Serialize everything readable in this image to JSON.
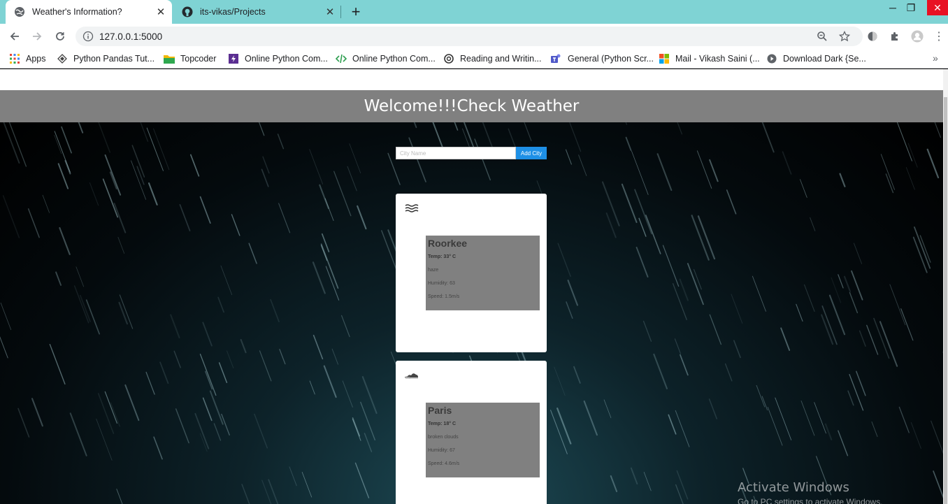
{
  "browser": {
    "tabs": [
      {
        "title": "Weather's Information?",
        "active": true
      },
      {
        "title": "its-vikas/Projects",
        "active": false
      }
    ],
    "url": "127.0.0.1:5000",
    "bookmarks": [
      {
        "label": "Apps",
        "icon": "apps-grid-icon"
      },
      {
        "label": "Python Pandas Tut...",
        "icon": "diamond-icon"
      },
      {
        "label": "Topcoder",
        "icon": "folder-icon"
      },
      {
        "label": "Online Python Com...",
        "icon": "bolt-icon"
      },
      {
        "label": "Online Python Com...",
        "icon": "code-icon"
      },
      {
        "label": "Reading and Writin...",
        "icon": "ring-icon"
      },
      {
        "label": "General (Python Scr...",
        "icon": "teams-icon"
      },
      {
        "label": "Mail - Vikash Saini (...",
        "icon": "microsoft-icon"
      },
      {
        "label": "Download Dark {Se...",
        "icon": "play-icon"
      }
    ]
  },
  "page": {
    "title": "Welcome!!!Check Weather",
    "search": {
      "placeholder": "City Name",
      "button_label": "Add City"
    },
    "cards": [
      {
        "icon": "haze-icon",
        "city": "Roorkee",
        "temp": "Temp: 33° C",
        "description": "haze",
        "humidity": "Humidity: 63",
        "speed": "Speed: 1.5m/s"
      },
      {
        "icon": "broken-clouds-icon",
        "city": "Paris",
        "temp": "Temp: 18° C",
        "description": "broken clouds",
        "humidity": "Humidity: 67",
        "speed": "Speed: 4.6m/s"
      }
    ]
  },
  "os_overlay": {
    "title": "Activate Windows",
    "subtitle": "Go to PC settings to activate Windows."
  }
}
